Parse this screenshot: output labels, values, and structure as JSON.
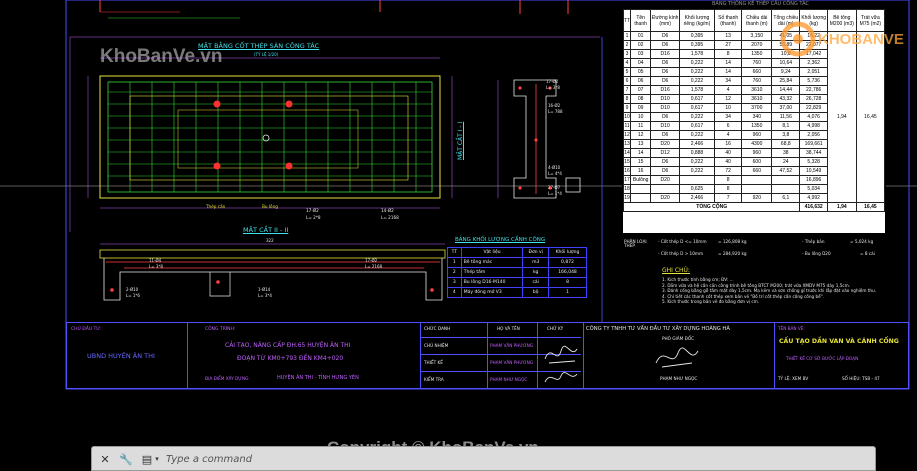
{
  "watermark": {
    "top_left": "KhoBanVe.vn",
    "bottom": "Copyright © KhoBanVe.vn",
    "logo": "KHOBANVE"
  },
  "plan_view": {
    "title": "MẶT BẰNG CỐT THÉP SÀN CÔNG TÁC",
    "scale": "(TỶ LỆ 1/20)",
    "dim_total": "322",
    "labels": [
      "Thép cấn",
      "Bu lông",
      "17-Ø2",
      "14-Ø2",
      "L= 2*8",
      "L= 2168"
    ]
  },
  "section_i": {
    "title": "MẶT CẮT I - I",
    "labels": [
      "17-Ø2",
      "L= 3*8",
      "16-Ø2",
      "L= 788",
      "4-Ø10",
      "L= 4*4",
      "27-Ø7",
      "L= 1*4"
    ]
  },
  "section_ii": {
    "title": "MẶT CẮT II - II",
    "dim_total": "322",
    "labels": [
      "11-Ø4",
      "L= 3*8",
      "2-Ø10",
      "L= 1*6",
      "17-Ø2",
      "L= 2168",
      "1-Ø14",
      "L= 3*4"
    ]
  },
  "materials": {
    "title": "BẢNG THỐNG KÊ THÉP CẦU CÔNG TÁC",
    "headers": [
      "TT",
      "Tên thanh",
      "Đường kính (mm)",
      "Khối lượng riêng (kg/m)",
      "Số thanh (thanh)",
      "Chiều dài thanh (m)",
      "Tổng chiều dài (m)",
      "Khối lượng (kg)",
      "Bê tông M200 (m3)",
      "Trát vữa M75 (m2)"
    ],
    "rows": [
      [
        "1",
        "01",
        "D6",
        "0,395",
        "13",
        "3,150",
        "41,05",
        "16,22"
      ],
      [
        "2",
        "02",
        "D6",
        "0,395",
        "27",
        "2070",
        "55,89",
        "22,077"
      ],
      [
        "3",
        "03",
        "D16",
        "1,578",
        "8",
        "1350",
        "10,8",
        "17,042"
      ],
      [
        "4",
        "04",
        "D6",
        "0,222",
        "14",
        "760",
        "10,64",
        "2,362"
      ],
      [
        "5",
        "05",
        "D6",
        "0,222",
        "14",
        "660",
        "9,24",
        "2,051"
      ],
      [
        "6",
        "06",
        "D6",
        "0,222",
        "34",
        "760",
        "25,84",
        "5,736"
      ],
      [
        "7",
        "07",
        "D16",
        "1,578",
        "4",
        "3610",
        "14,44",
        "22,786"
      ],
      [
        "8",
        "08",
        "D10",
        "0,617",
        "12",
        "3610",
        "43,32",
        "26,728"
      ],
      [
        "9",
        "09",
        "D10",
        "0,617",
        "10",
        "3700",
        "37,00",
        "22,829"
      ],
      [
        "10",
        "10",
        "D6",
        "0,222",
        "34",
        "340",
        "11,56",
        "4,076"
      ],
      [
        "11",
        "11",
        "D10",
        "0,617",
        "6",
        "1350",
        "8,1",
        "4,998"
      ],
      [
        "12",
        "12",
        "D6",
        "0,222",
        "4",
        "960",
        "3,8",
        "2,056"
      ],
      [
        "13",
        "13",
        "D20",
        "2,466",
        "16",
        "4300",
        "68,8",
        "169,661"
      ],
      [
        "14",
        "14",
        "D12",
        "0,888",
        "40",
        "960",
        "38",
        "38,744"
      ],
      [
        "15",
        "15",
        "D6",
        "0,222",
        "40",
        "600",
        "24",
        "5,328"
      ],
      [
        "16",
        "16",
        "D6",
        "0,222",
        "72",
        "660",
        "47,52",
        "10,549"
      ],
      [
        "17",
        "Bulông",
        "D20",
        "",
        "8",
        "",
        "",
        "16,896"
      ],
      [
        "18",
        "",
        "",
        "0,625",
        "8",
        "",
        "",
        "5,034"
      ],
      [
        "19",
        "",
        "D20",
        "2,466",
        "7",
        "920",
        "6,1",
        "4,992"
      ]
    ],
    "total_label": "TỔNG CỘNG",
    "total_kg": "416,632",
    "concrete": "1,94",
    "plaster": "16,45",
    "summary_label": "PHÂN LOẠI THÉP",
    "summary_lines": [
      "- Cốt thép D <= 10mm",
      "= 126,808 kg",
      "- Cốt thép D > 10mm",
      "= 284,920 kg"
    ],
    "summary_right": [
      "- Thép bản",
      "= 5,024 kg",
      "- Bu lông D20",
      "= 8 cái"
    ]
  },
  "concrete_table": {
    "title": "BẢNG KHỐI LƯỢNG CẦNH CÔNG",
    "headers": [
      "TT",
      "Vật liệu",
      "Đơn vị",
      "Khối lượng"
    ],
    "rows": [
      [
        "1",
        "Bê tông mác",
        "m3",
        "0,872"
      ],
      [
        "2",
        "Thép tấm",
        "kg",
        "166,048"
      ],
      [
        "3",
        "Bu lông D16-M140",
        "cái",
        "8"
      ],
      [
        "4",
        "Máy đóng mở V3",
        "bộ",
        "1"
      ]
    ]
  },
  "notes": {
    "title": "GHI CHÚ:",
    "lines": [
      "1. Kích thước tính bằng cm; ĐV: ...",
      "2. Dầm vữa và hệ cấn cần công trình bê tông BTCT M200; trát vữa XMDV M75 dày 1,5cm.",
      "3. Đánh cống bằng gỗ tấm mặt dày 1,5cm. Mạ kẽm và sơn chống gỉ trước khi lắp đặt vào nghiệm thu.",
      "4. Chi tiết các thanh cốt thép xem bản vẽ \"Bố trí cốt thép cấn công cống bể\".",
      "5. Kích thước trong bản vẽ đo bằng đơn vị cm."
    ]
  },
  "title_block": {
    "owner_label": "CHỦ ĐẦU TƯ:",
    "owner": "UBND HUYỆN ÂN THI",
    "project_label": "CÔNG TRÌNH:",
    "project_lines": [
      "CẢI TẠO, NÂNG CẤP ĐH.65 HUYỆN ÂN THI",
      "ĐOẠN TỪ KM0+793 ĐẾN KM4+020"
    ],
    "location_label": "ĐỊA ĐIỂM XÂY DỰNG:",
    "location": "HUYỆN ÂN THI - TỈNH HƯNG YÊN",
    "roles_header": [
      "CHỨC DANH",
      "HỌ VÀ TÊN",
      "CHỮ KÝ"
    ],
    "roles": [
      [
        "CHỦ NHIỆM",
        "PHẠM VĂN PHƯƠNG"
      ],
      [
        "THIẾT KẾ",
        "PHẠM VĂN PHƯƠNG"
      ],
      [
        "KIỂM TRA",
        "PHẠM NHƯ NGỌC"
      ]
    ],
    "company": "CÔNG TY TNHH TƯ VẤN ĐẦU TƯ XÂY DỰNG HOÀNG HÀ",
    "director_title": "PHÓ GIÁM ĐỐC",
    "director_name": "PHẠM NHƯ NGỌC",
    "drawing_label": "TÊN BẢN VẼ:",
    "drawing_title": "CẤU TẠO DẦN VAN VÀ CÁNH CỐNG",
    "drawing_subtitle": "THIẾT KẾ CƠ SỞ BƯỚC LẬP ĐOẠN",
    "scale": "TỶ LỆ: XEM BV",
    "sheet": "SỐ HIỆU: TSB - 47"
  },
  "command_bar": {
    "placeholder": "Type a command"
  }
}
